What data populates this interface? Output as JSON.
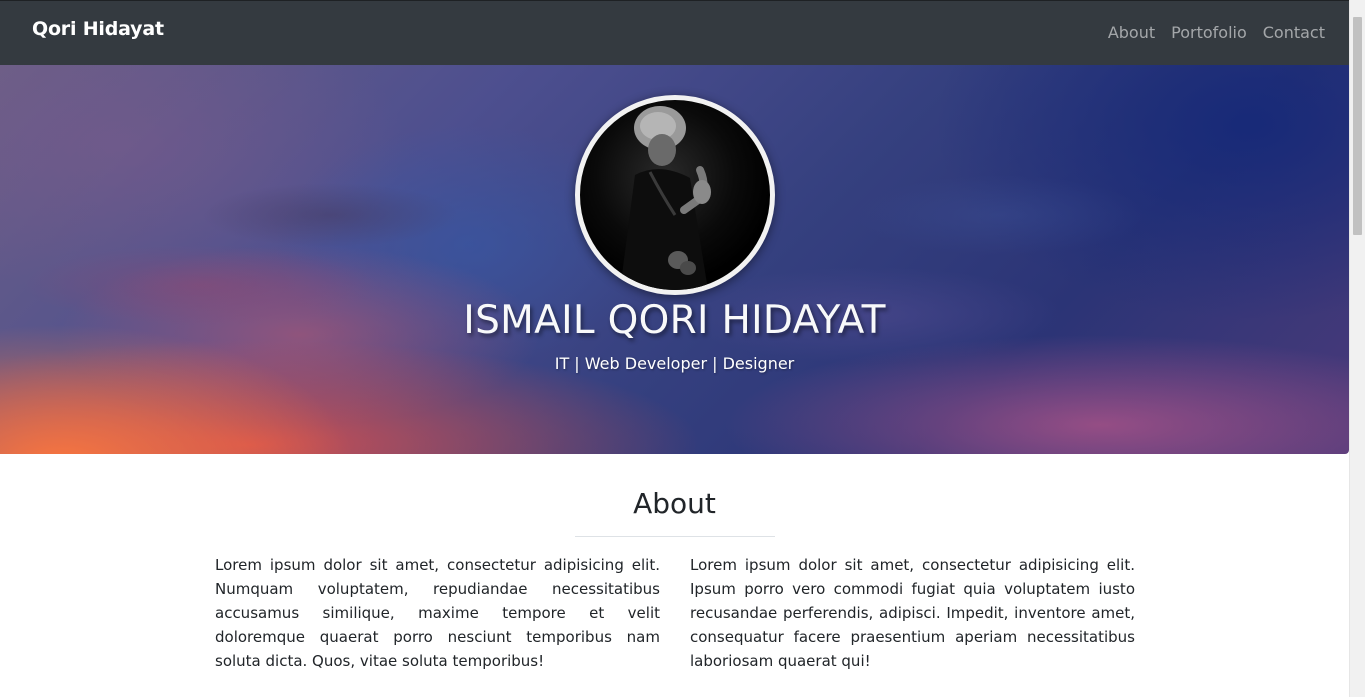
{
  "navbar": {
    "brand": "Qori Hidayat",
    "links": [
      "About",
      "Portofolio",
      "Contact"
    ]
  },
  "hero": {
    "name": "ISMAIL QORI HIDAYAT",
    "tagline": "IT | Web Developer | Designer",
    "avatar_icon": "profile-photo"
  },
  "about": {
    "title": "About",
    "paragraphs": [
      "Lorem ipsum dolor sit amet, consectetur adipisicing elit. Numquam voluptatem, repudiandae necessitatibus accusamus similique, maxime tempore et velit doloremque quaerat porro nesciunt temporibus nam soluta dicta. Quos, vitae soluta temporibus!",
      "Lorem ipsum dolor sit amet, consectetur adipisicing elit. Ipsum porro vero commodi fugiat quia voluptatem iusto recusandae perferendis, adipisci. Impedit, inventore amet, consequatur facere praesentium aperiam necessitatibus laboriosam quaerat qui!"
    ]
  },
  "colors": {
    "navbar_bg": "#343a40",
    "nav_link": "#9a9da0",
    "heading": "#212529"
  }
}
